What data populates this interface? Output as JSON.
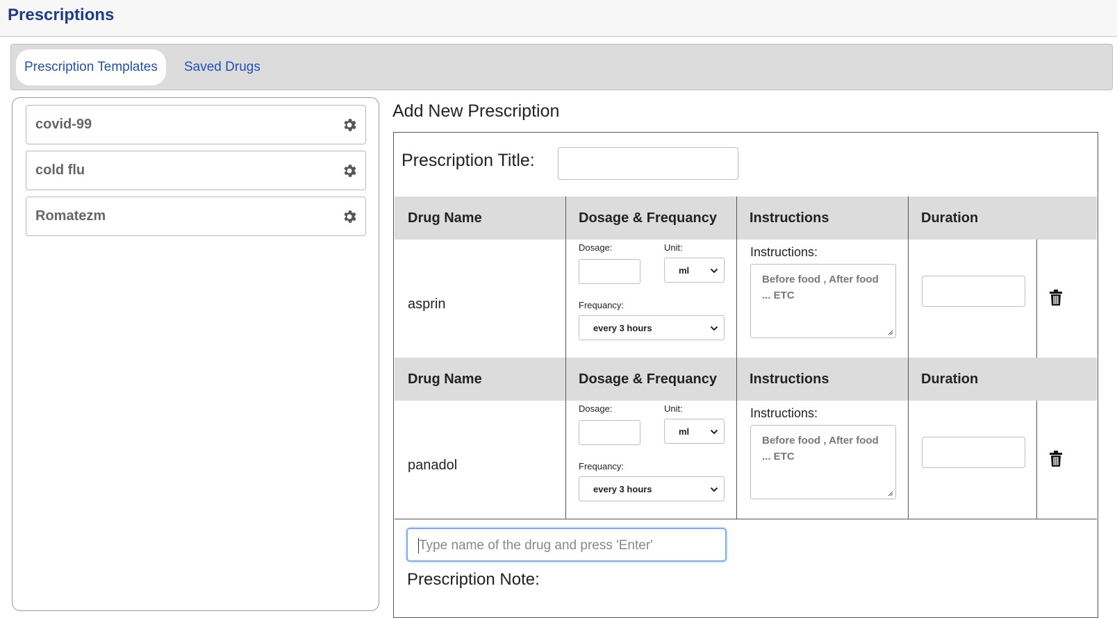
{
  "header": {
    "title": "Prescriptions"
  },
  "tabs": [
    {
      "label": "Prescription Templates",
      "active": true
    },
    {
      "label": "Saved Drugs",
      "active": false
    }
  ],
  "templates": [
    {
      "name": "covid-99",
      "icon": "gear-icon"
    },
    {
      "name": "cold flu",
      "icon": "gear-icon"
    },
    {
      "name": "Romatezm",
      "icon": "gear-icon"
    }
  ],
  "form": {
    "heading": "Add New Prescription",
    "title_label": "Prescription Title:",
    "title_value": "",
    "columns": [
      "Drug Name",
      "Dosage & Frequancy",
      "Instructions",
      "Duration"
    ],
    "dosage_label": "Dosage:",
    "unit_label": "Unit:",
    "frequency_label": "Frequancy:",
    "instructions_label": "Instructions:",
    "instructions_placeholder": "Before food , After food ... ETC",
    "drugs": [
      {
        "name": "asprin",
        "dosage": "",
        "unit": "ml",
        "frequency": "every 3 hours",
        "instructions": "",
        "duration": ""
      },
      {
        "name": "panadol",
        "dosage": "",
        "unit": "ml",
        "frequency": "every 3 hours",
        "instructions": "",
        "duration": ""
      }
    ],
    "drug_search_placeholder": "Type name of the drug and press 'Enter'",
    "note_label": "Prescription Note:"
  },
  "colors": {
    "brand": "#1f3c88",
    "tab_link": "#2050b8",
    "header_bg": "#dcdcdc",
    "focus": "#7aaef0"
  }
}
